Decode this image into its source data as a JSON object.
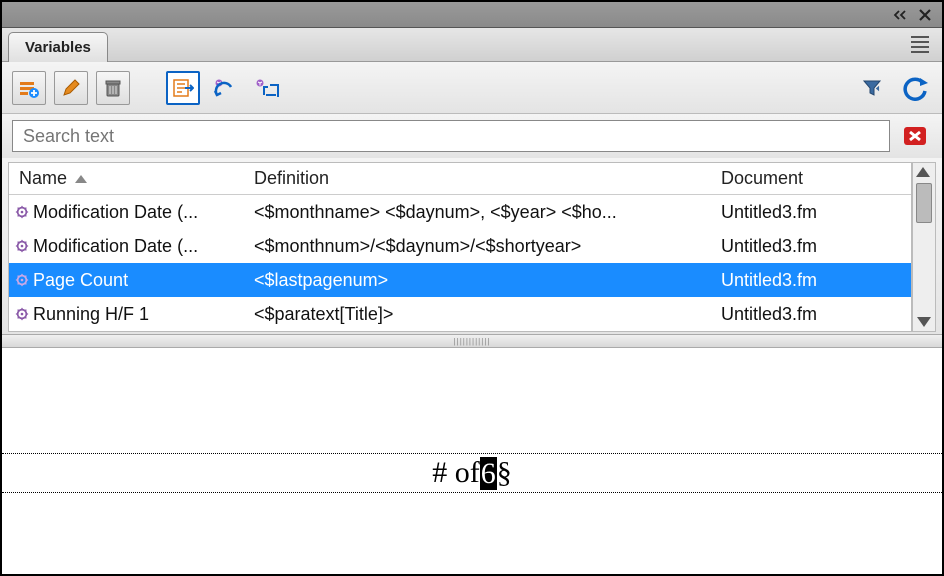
{
  "tab": {
    "label": "Variables"
  },
  "search": {
    "placeholder": "Search text"
  },
  "columns": {
    "name": "Name",
    "definition": "Definition",
    "document": "Document"
  },
  "rows": [
    {
      "name": "Modification Date (...",
      "definition": "<$monthname> <$daynum>, <$year> <$ho...",
      "document": "Untitled3.fm",
      "selected": false
    },
    {
      "name": "Modification Date (...",
      "definition": "<$monthnum>/<$daynum>/<$shortyear>",
      "document": "Untitled3.fm",
      "selected": false
    },
    {
      "name": "Page Count",
      "definition": "<$lastpagenum>",
      "document": "Untitled3.fm",
      "selected": true
    },
    {
      "name": "Running H/F 1",
      "definition": "<$paratext[Title]>",
      "document": "Untitled3.fm",
      "selected": false
    }
  ],
  "docline": {
    "prefix": "# of ",
    "highlight": "6",
    "suffix": "§"
  }
}
